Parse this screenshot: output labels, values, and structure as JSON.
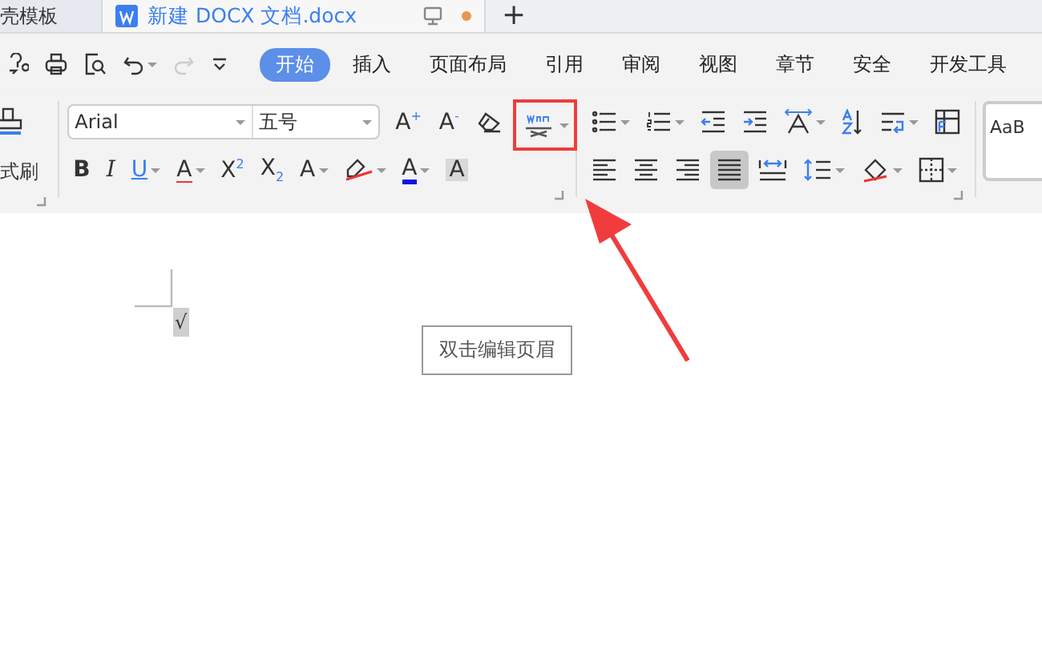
{
  "tabs": [
    {
      "label": "壳模板",
      "selected": false
    },
    {
      "label": "新建 DOCX 文档.docx",
      "selected": true,
      "unsaved": true
    }
  ],
  "new_tab": "+",
  "menu": [
    {
      "label": "开始",
      "selected": true
    },
    {
      "label": "插入",
      "selected": false
    },
    {
      "label": "页面布局",
      "selected": false
    },
    {
      "label": "引用",
      "selected": false
    },
    {
      "label": "审阅",
      "selected": false
    },
    {
      "label": "视图",
      "selected": false
    },
    {
      "label": "章节",
      "selected": false
    },
    {
      "label": "安全",
      "selected": false
    },
    {
      "label": "开发工具",
      "selected": false
    }
  ],
  "format_painter": {
    "label": "式刷"
  },
  "font": {
    "name": "Arial",
    "size": "五号"
  },
  "font_row1": [
    {
      "kind": "glyph",
      "text": "A$^{+}$"
    },
    {
      "kind": "glyph",
      "text": "A$^{-}$"
    },
    {
      "kind": "icon"
    },
    {
      "kind": "icon",
      "dropdown": true,
      "highlighted": true
    }
  ],
  "font_row2": [
    {
      "kind": "glyph",
      "text": "B"
    },
    {
      "kind": "glyph",
      "text": "I"
    },
    {
      "kind": "glyph",
      "text": "U",
      "dropdown": true
    },
    {
      "kind": "glyph",
      "text": "A",
      "dropdown": true
    },
    {
      "kind": "glyph",
      "text": "X$^{2}$"
    },
    {
      "kind": "glyph",
      "text": "X$_{2}$"
    },
    {
      "kind": "glyph",
      "text": "A",
      "dropdown": true
    },
    {
      "kind": "icon",
      "dropdown": true
    },
    {
      "kind": "glyph",
      "text": "A",
      "dropdown": true
    },
    {
      "kind": "glyph",
      "text": "A",
      "shaded": true
    }
  ],
  "para_row1": [
    {
      "dropdown": true,
      "selected": false
    },
    {
      "dropdown": true,
      "selected": false
    },
    {
      "dropdown": false,
      "selected": false
    },
    {
      "dropdown": false,
      "selected": false
    },
    {
      "dropdown": true,
      "selected": false
    },
    {
      "dropdown": false,
      "selected": false
    },
    {
      "dropdown": true,
      "selected": false
    },
    {
      "dropdown": false,
      "selected": false
    }
  ],
  "para_row2": [
    {
      "dropdown": false,
      "selected": false
    },
    {
      "dropdown": false,
      "selected": false
    },
    {
      "dropdown": false,
      "selected": false
    },
    {
      "dropdown": false,
      "selected": true
    },
    {
      "dropdown": false,
      "selected": false
    },
    {
      "dropdown": true,
      "selected": false
    },
    {
      "dropdown": true,
      "selected": false
    },
    {
      "dropdown": true,
      "selected": false
    }
  ],
  "style_preview": "AaB",
  "document": {
    "cursor_mark": "√",
    "header_hint": "双击编辑页眉"
  },
  "annotation_arrow": true
}
